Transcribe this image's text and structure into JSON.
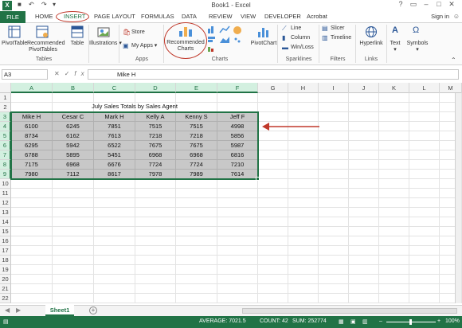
{
  "window": {
    "title": "Book1 - Excel",
    "signin": "Sign in"
  },
  "tabs": [
    "FILE",
    "HOME",
    "INSERT",
    "PAGE LAYOUT",
    "FORMULAS",
    "DATA",
    "REVIEW",
    "VIEW",
    "DEVELOPER",
    "Acrobat"
  ],
  "ribbon": {
    "pivottable": "PivotTable",
    "recommended_pivottables": [
      "Recommended",
      "PivotTables"
    ],
    "table": "Table",
    "illustrations": "Illustrations",
    "store": "Store",
    "my_apps": "My Apps",
    "recommended_charts": [
      "Recommended",
      "Charts"
    ],
    "pivotchart": "PivotChart",
    "line": "Line",
    "column": "Column",
    "win_loss": "Win/Loss",
    "slicer": "Slicer",
    "timeline": "Timeline",
    "hyperlink": "Hyperlink",
    "text": "Text",
    "symbols": "Symbols",
    "groups": {
      "tables": "Tables",
      "apps": "Apps",
      "charts": "Charts",
      "sparklines": "Sparklines",
      "filters": "Filters",
      "links": "Links"
    }
  },
  "formula_bar": {
    "name_box": "A3",
    "content": "Mike H"
  },
  "columns": [
    "A",
    "B",
    "C",
    "D",
    "E",
    "F",
    "G",
    "H",
    "I",
    "J",
    "K",
    "L",
    "M"
  ],
  "rows": [
    1,
    2,
    3,
    4,
    5,
    6,
    7,
    8,
    9,
    10,
    11,
    12,
    13,
    14,
    15,
    16,
    17,
    18,
    19,
    20,
    21,
    22
  ],
  "sheet": {
    "title": "July Sales Totals by Sales Agent",
    "headers": [
      "Mike H",
      "Cesar C",
      "Mark H",
      "Kelly A",
      "Kenny S",
      "Jeff F"
    ],
    "values": [
      [
        6100,
        6245,
        7851,
        7515,
        7515,
        4998
      ],
      [
        8734,
        6162,
        7613,
        7218,
        7218,
        5856
      ],
      [
        6295,
        5942,
        6522,
        7675,
        7675,
        5987
      ],
      [
        6788,
        5895,
        5451,
        6968,
        6968,
        6816
      ],
      [
        7175,
        6968,
        6676,
        7724,
        7724,
        7210
      ],
      [
        7980,
        7112,
        8617,
        7978,
        7989,
        7614
      ]
    ]
  },
  "sheet_tabs": [
    "Sheet1"
  ],
  "status": {
    "average": "AVERAGE: 7021.5",
    "count": "COUNT: 42",
    "sum": "SUM: 252774",
    "zoom": "100%"
  }
}
